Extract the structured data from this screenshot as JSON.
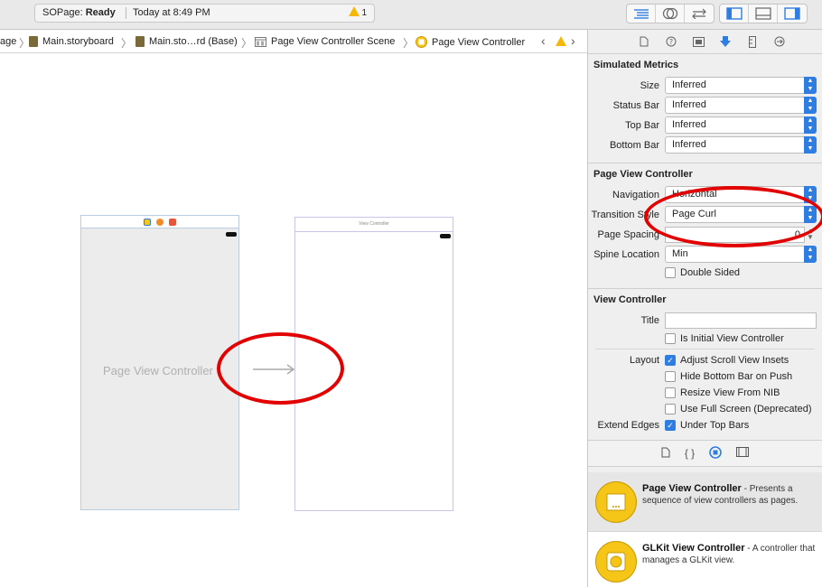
{
  "toolbar": {
    "project": "SOPage:",
    "status": "Ready",
    "time": "Today at 8:49 PM",
    "warning_count": "1"
  },
  "breadcrumbs": [
    {
      "label": "age"
    },
    {
      "label": "Main.storyboard"
    },
    {
      "label": "Main.sto…rd (Base)"
    },
    {
      "label": "Page View Controller Scene"
    },
    {
      "label": "Page View Controller"
    }
  ],
  "canvas": {
    "pvc_label": "Page View Controller",
    "vc_title": "View Controller"
  },
  "inspector": {
    "simulated": {
      "title": "Simulated Metrics",
      "size_label": "Size",
      "size_value": "Inferred",
      "status_label": "Status Bar",
      "status_value": "Inferred",
      "top_label": "Top Bar",
      "top_value": "Inferred",
      "bottom_label": "Bottom Bar",
      "bottom_value": "Inferred"
    },
    "pvc": {
      "title": "Page View Controller",
      "nav_label": "Navigation",
      "nav_value": "Horizontal",
      "transition_label": "Transition Style",
      "transition_value": "Page Curl",
      "spacing_label": "Page Spacing",
      "spacing_value": "0",
      "spine_label": "Spine Location",
      "spine_value": "Min",
      "double_sided": "Double Sided"
    },
    "vc": {
      "title": "View Controller",
      "title_label": "Title",
      "initial": "Is Initial View Controller",
      "layout_label": "Layout",
      "adjust": "Adjust Scroll View Insets",
      "hide_bottom": "Hide Bottom Bar on Push",
      "resize_nib": "Resize View From NIB",
      "full_screen": "Use Full Screen (Deprecated)",
      "edges_label": "Extend Edges",
      "under_top": "Under Top Bars"
    }
  },
  "library": [
    {
      "name": "Page View Controller",
      "desc": " - Presents a sequence of view controllers as pages."
    },
    {
      "name": "GLKit View Controller",
      "desc": " - A controller that manages a GLKit view."
    }
  ],
  "colors": {
    "accent": "#2f7de1",
    "annotation": "#e30000",
    "library_icon": "#f5c518"
  }
}
